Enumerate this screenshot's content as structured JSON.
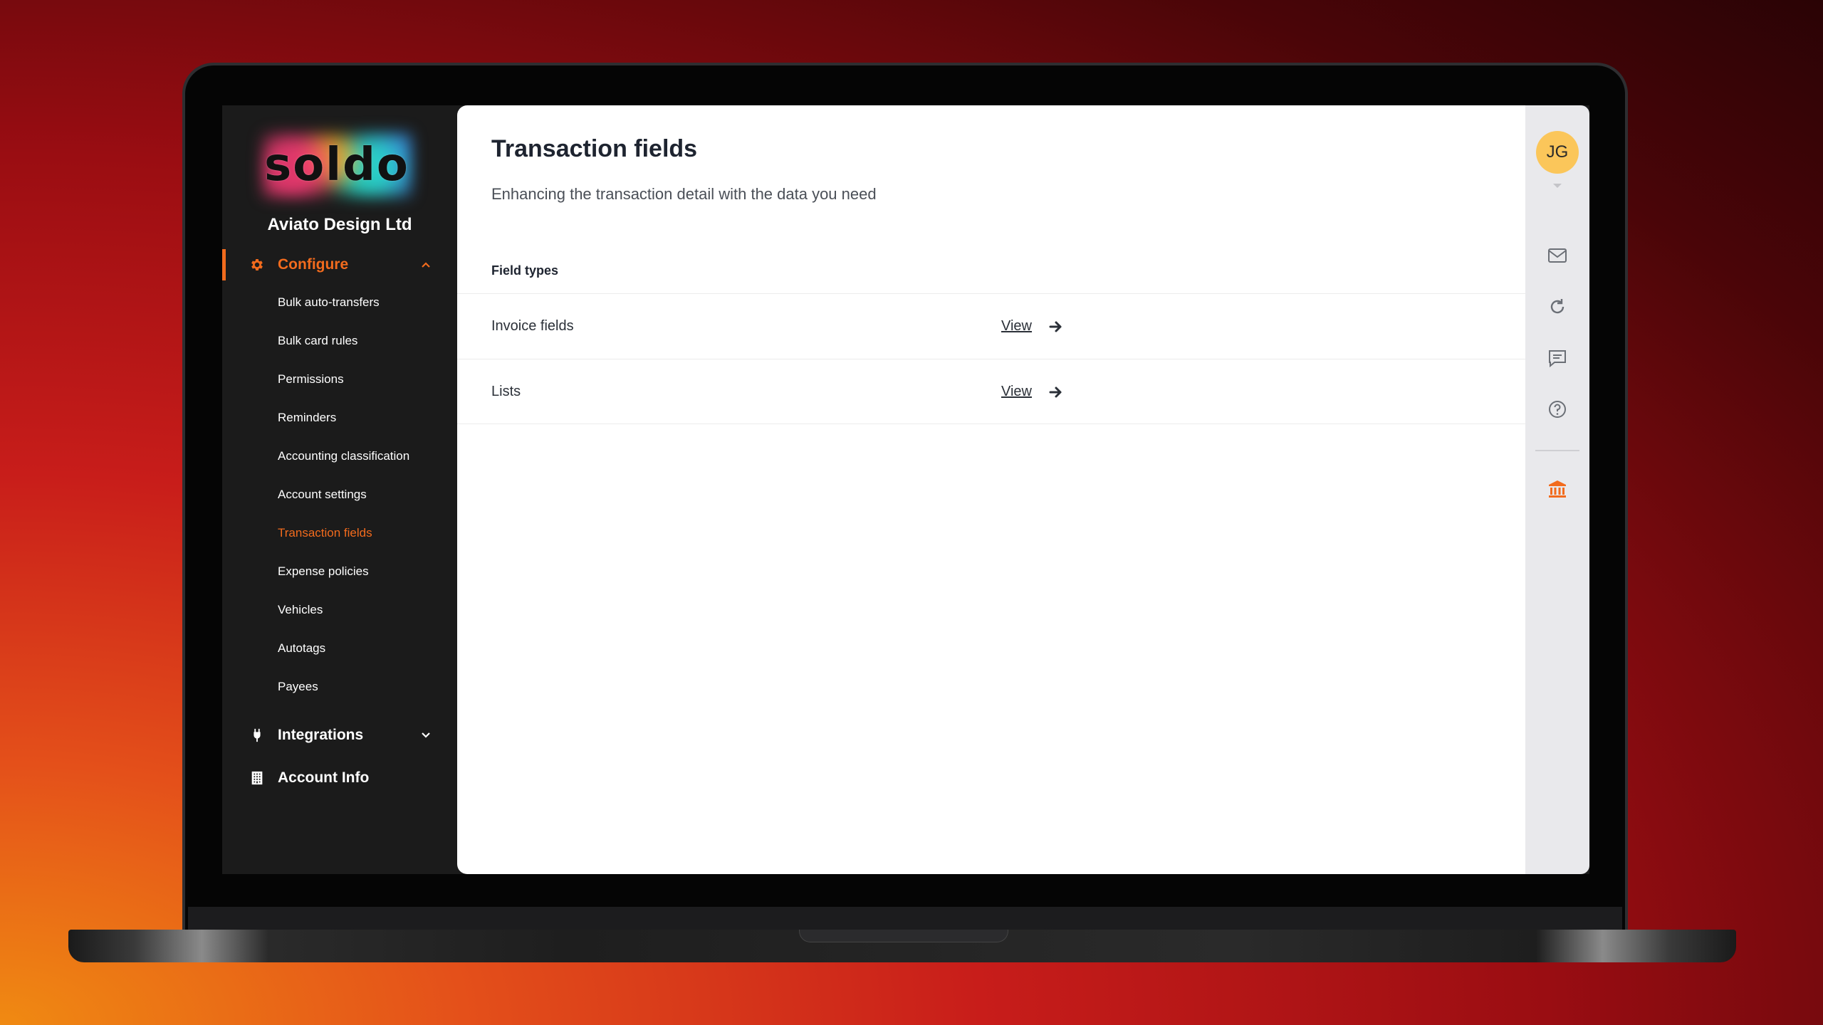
{
  "sidebar": {
    "logo_text": "soldo",
    "company_name": "Aviato Design Ltd",
    "configure": {
      "label": "Configure",
      "items": [
        {
          "label": "Bulk auto-transfers"
        },
        {
          "label": "Bulk card rules"
        },
        {
          "label": "Permissions"
        },
        {
          "label": "Reminders"
        },
        {
          "label": "Accounting classification"
        },
        {
          "label": "Account settings"
        },
        {
          "label": "Transaction fields",
          "active": true
        },
        {
          "label": "Expense policies"
        },
        {
          "label": "Vehicles"
        },
        {
          "label": "Autotags"
        },
        {
          "label": "Payees"
        }
      ]
    },
    "integrations": {
      "label": "Integrations"
    },
    "account_info": {
      "label": "Account Info"
    }
  },
  "main": {
    "title": "Transaction fields",
    "subtitle": "Enhancing the transaction detail with the data you need",
    "section_header": "Field types",
    "rows": [
      {
        "name": "Invoice fields",
        "action": "View"
      },
      {
        "name": "Lists",
        "action": "View"
      }
    ]
  },
  "rail": {
    "avatar_initials": "JG",
    "icons": [
      "mail-icon",
      "refresh-icon",
      "chat-icon",
      "help-icon",
      "bank-icon"
    ]
  },
  "colors": {
    "accent": "#f26b1d",
    "sidebar_bg": "#1b1b1b",
    "avatar_bg": "#fbc65a"
  }
}
